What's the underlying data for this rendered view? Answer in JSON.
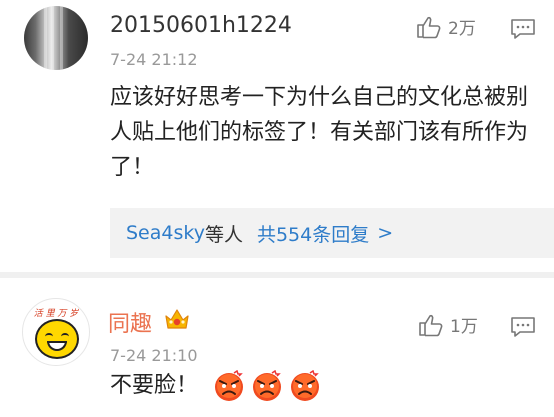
{
  "comments": [
    {
      "username": "20150601h1224",
      "timestamp": "7-24  21:12",
      "likes": "2万",
      "body": "应该好好思考一下为什么自己的文化总被别人贴上他们的标签了！有关部门该有所作为了！",
      "replies": {
        "who": "Sea4sky",
        "and_others": "等人",
        "total": "共554条回复",
        "chevron": ">"
      }
    },
    {
      "username": "同趣",
      "avatar_caption": "活 里 万 岁",
      "timestamp": "7-24  21:10",
      "likes": "1万",
      "body": "不要脸！",
      "emoji_count": 3,
      "emoji_name": "angry-face-icon"
    }
  ],
  "colors": {
    "link_blue": "#2e7cc9",
    "vip_orange": "#eb7350",
    "timestamp_gray": "#999999",
    "reply_bg": "#f2f2f2"
  },
  "icons": {
    "like": "thumbs-up-icon",
    "reply": "comment-bubble-icon",
    "badge": "vip-crown-badge-icon"
  }
}
